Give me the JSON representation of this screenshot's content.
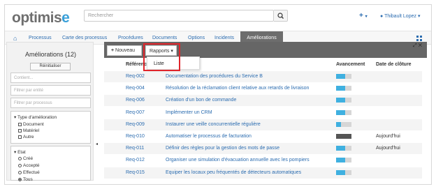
{
  "header": {
    "logo_main": "optimis",
    "logo_accent": "e",
    "search_placeholder": "Rechercher",
    "plus_label": "+",
    "user_name": "Thibault Lopez"
  },
  "nav": {
    "items": [
      "Processus",
      "Carte des processus",
      "Procédures",
      "Documents",
      "Options",
      "Incidents"
    ],
    "active": "Améliorations"
  },
  "sidebar": {
    "title": "Améliorations (12)",
    "reset_label": "Réinitialiser",
    "content_placeholder": "Contient...",
    "entity_placeholder": "Filtrer par entité",
    "process_placeholder": "Filtrer par processus",
    "type_filter": {
      "title": "Type d'amélioration",
      "options": [
        "Document",
        "Matériel",
        "Autre"
      ]
    },
    "state_filter": {
      "title": "Etat",
      "options": [
        "Créé",
        "Accepté",
        "Effectué",
        "Tous"
      ],
      "selected": "Tous"
    }
  },
  "toolbar": {
    "new_label": "Nouveau",
    "reports_label": "Rapports",
    "dropdown_item": "Liste",
    "highlight_color": "#e1252b"
  },
  "table": {
    "headers": {
      "ref": "Référence",
      "progress": "Avancement",
      "closing": "Date de clôture"
    },
    "rows": [
      {
        "ref": "Req-002",
        "desc": "Documentation des procédures du Service B",
        "progress": 0.6,
        "date": ""
      },
      {
        "ref": "Req-004",
        "desc": "Résolution de la réclamation client relative aux retards de livraison",
        "progress": 0.6,
        "date": ""
      },
      {
        "ref": "Req-006",
        "desc": "Création d'un bon de commande",
        "progress": 0.6,
        "date": ""
      },
      {
        "ref": "Req-007",
        "desc": "Implémenter un CRM",
        "progress": 0.6,
        "date": ""
      },
      {
        "ref": "Req-009",
        "desc": "Instaurer une veille concurrentielle régulière",
        "progress": 0.3,
        "date": ""
      },
      {
        "ref": "Req-010",
        "desc": "Automatiser le processus de facturation",
        "progress": 1.0,
        "date": "Aujourd'hui"
      },
      {
        "ref": "Req-011",
        "desc": "Définir des règles pour la gestion des mots de passe",
        "progress": 0.6,
        "date": "Aujourd'hui"
      },
      {
        "ref": "Req-012",
        "desc": "Organiser une simulation d'évacuation annuelle avec les pompiers",
        "progress": 0.6,
        "date": ""
      },
      {
        "ref": "Req-015",
        "desc": "Equiper les locaux peu fréquentés de détecteurs automatiques",
        "progress": 0.6,
        "date": ""
      }
    ],
    "bar_fill_color": "#3fb0e0",
    "bar_done_color": "#555555"
  }
}
